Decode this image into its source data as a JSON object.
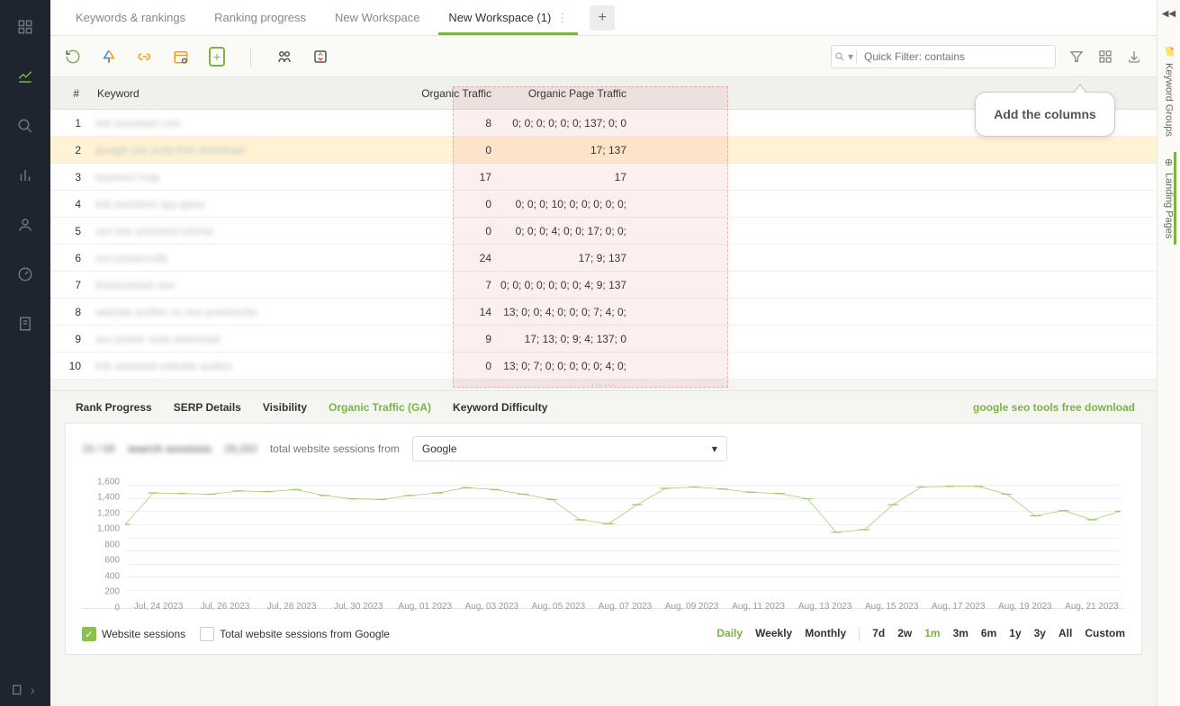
{
  "left_nav": {
    "items": [
      "grid",
      "chart",
      "search",
      "bars",
      "user",
      "gauge",
      "doc"
    ],
    "bottom_icon": "collapse"
  },
  "tabs": {
    "items": [
      "Keywords & rankings",
      "Ranking progress",
      "New Workspace",
      "New Workspace (1)"
    ],
    "active_index": 3
  },
  "toolbar": {
    "quick_filter_placeholder": "Quick Filter: contains"
  },
  "columns_tooltip": "Add the columns",
  "table": {
    "headers": {
      "num": "#",
      "keyword": "Keyword",
      "ot": "Organic Traffic",
      "opt": "Organic Page Traffic"
    },
    "rows": [
      {
        "num": 1,
        "kw": "link assistant com",
        "ot": 8,
        "opt": "0; 0; 0; 0; 0; 0; 137; 0; 0"
      },
      {
        "num": 2,
        "kw": "google seo tools free download",
        "ot": 0,
        "opt": "17; 137",
        "selected": true
      },
      {
        "num": 3,
        "kw": "keyword map",
        "ot": 17,
        "opt": "17"
      },
      {
        "num": 4,
        "kw": "link assistant spy glass",
        "ot": 0,
        "opt": "0; 0; 0; 10; 0; 0; 0; 0; 0;"
      },
      {
        "num": 5,
        "kw": "seo link assistant tutorial",
        "ot": 0,
        "opt": "0; 0; 0; 4; 0; 0; 17; 0; 0;"
      },
      {
        "num": 6,
        "kw": "seo powersuite",
        "ot": 24,
        "opt": "17; 9; 137"
      },
      {
        "num": 7,
        "kw": "linkassistant seo",
        "ot": 7,
        "opt": "0; 0; 0; 0; 0; 0; 0; 4; 9; 137"
      },
      {
        "num": 8,
        "kw": "website auditor vs seo powersuite",
        "ot": 14,
        "opt": "13; 0; 0; 4; 0; 0; 0; 7; 4; 0;"
      },
      {
        "num": 9,
        "kw": "seo power suite download",
        "ot": 9,
        "opt": "17; 13; 0; 9; 4; 137; 0"
      },
      {
        "num": 10,
        "kw": "link assistant website auditor",
        "ot": 0,
        "opt": "13; 0; 7; 0; 0; 0; 0; 0; 4; 0;"
      }
    ]
  },
  "lower_tabs": {
    "items": [
      "Rank Progress",
      "SERP Details",
      "Visibility",
      "Organic Traffic (GA)",
      "Keyword Difficulty"
    ],
    "active_index": 3,
    "right_link": "google seo tools free download"
  },
  "chart_header": {
    "stat1": "16 / 68",
    "stat1_label": "search sessions",
    "stat2": "28,262",
    "stat2_label": "total website sessions from",
    "dropdown_value": "Google"
  },
  "chart_data": {
    "type": "line",
    "series": [
      {
        "name": "Website sessions",
        "values": [
          1000,
          1480,
          1470,
          1460,
          1510,
          1500,
          1530,
          1440,
          1390,
          1380,
          1440,
          1480,
          1560,
          1530,
          1460,
          1380,
          1070,
          1010,
          1300,
          1550,
          1570,
          1540,
          1490,
          1470,
          1390,
          880,
          920,
          1300,
          1570,
          1580,
          1580,
          1460,
          1130,
          1210,
          1070,
          1200
        ]
      }
    ],
    "x_categories": [
      "Jul, 24 2023",
      "Jul, 26 2023",
      "Jul, 28 2023",
      "Jul, 30 2023",
      "Aug, 01 2023",
      "Aug, 03 2023",
      "Aug, 05 2023",
      "Aug, 07 2023",
      "Aug, 09 2023",
      "Aug, 11 2023",
      "Aug, 13 2023",
      "Aug, 15 2023",
      "Aug, 17 2023",
      "Aug, 19 2023",
      "Aug, 21 2023"
    ],
    "yticks": [
      0,
      200,
      400,
      600,
      800,
      1000,
      1200,
      1400,
      1600
    ],
    "ylim": [
      0,
      1700
    ]
  },
  "legend": {
    "item1": "Website sessions",
    "item2": "Total website sessions from Google"
  },
  "ranges": {
    "granularity": [
      "Daily",
      "Weekly",
      "Monthly"
    ],
    "granularity_active": 0,
    "periods": [
      "7d",
      "2w",
      "1m",
      "3m",
      "6m",
      "1y",
      "3y",
      "All",
      "Custom"
    ],
    "period_active": 2
  },
  "right_sidebar": {
    "tab1": "Keyword Groups",
    "tab2": "Landing Pages",
    "active": 1
  }
}
